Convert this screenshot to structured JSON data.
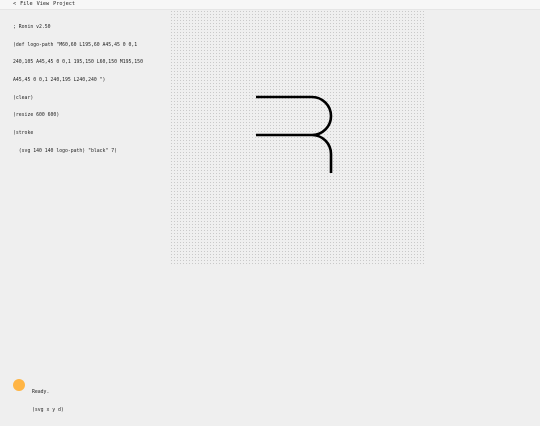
{
  "menubar": {
    "items": [
      {
        "label": "<"
      },
      {
        "label": "File"
      },
      {
        "label": "View"
      },
      {
        "label": "Project"
      }
    ]
  },
  "editor": {
    "lines": [
      "; Ronin v2.50",
      "(def logo-path \"M60,60 L195,60 A45,45 0 0,1",
      "240,105 A45,45 0 0,1 195,150 L60,150 M195,150",
      "A45,45 0 0,1 240,195 L240,240 \")",
      "(clear)",
      "(resize 600 600)",
      "(stroke",
      "  (svg 140 140 logo-path) \"black\" 7)"
    ]
  },
  "canvas": {
    "stroke_color": "#000000",
    "grid_dot_color": "#c9c9c9"
  },
  "status": {
    "indicator_color": "#ffb545",
    "message": "Ready.",
    "hint": "(svg x y d)"
  }
}
